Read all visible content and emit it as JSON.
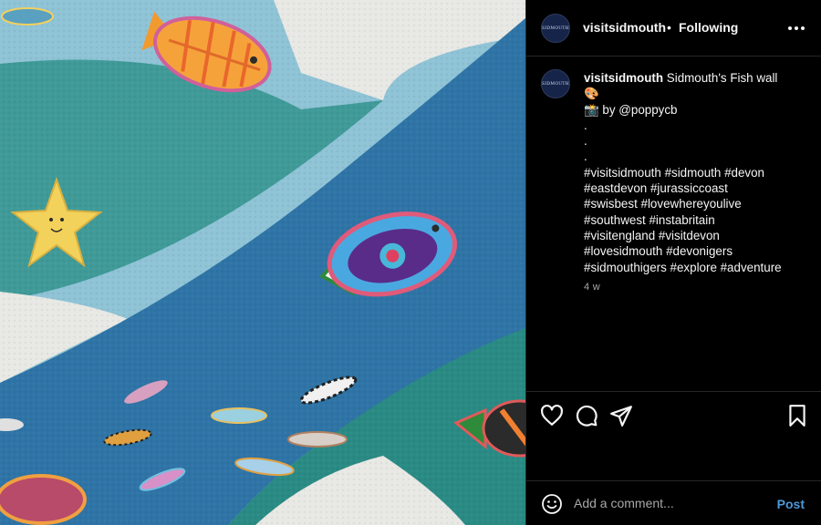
{
  "media": {
    "subject": "Painted wall mural with fish and starfish",
    "colors": {
      "light_band": "#8fc3d6",
      "teal_band": "#3f9a98",
      "blue_band": "#2f74a6",
      "deep_teal": "#2a8a84",
      "white_band": "#e8e8e4"
    }
  },
  "header": {
    "avatar_text": "SIDMOUTH",
    "username": "visitsidmouth",
    "separator": "•",
    "follow_status": "Following",
    "more_icon": "more-horizontal-icon"
  },
  "caption": {
    "avatar_text": "SIDMOUTH",
    "username": "visitsidmouth",
    "title": "Sidmouth's Fish wall",
    "line2_emoji": "🎨",
    "line3_emoji": "📸",
    "line3_text": "by @poppycb",
    "dots": [
      ".",
      ".",
      "."
    ],
    "hashtag_lines": [
      "#visitsidmouth #sidmouth #devon",
      "#eastdevon #jurassiccoast",
      "#swisbest #lovewhereyoulive",
      "#southwest #instabritain",
      "#visitengland #visitdevon",
      "#lovesidmouth #devonigers",
      "#sidmouthigers #explore #adventure"
    ],
    "timestamp": "4 w"
  },
  "actions": {
    "like_icon": "heart-icon",
    "comment_icon": "comment-icon",
    "share_icon": "send-icon",
    "save_icon": "bookmark-icon"
  },
  "comment_box": {
    "emoji_icon": "emoji-smile-icon",
    "placeholder": "Add a comment...",
    "post_label": "Post",
    "post_color": "#4e99d8"
  }
}
